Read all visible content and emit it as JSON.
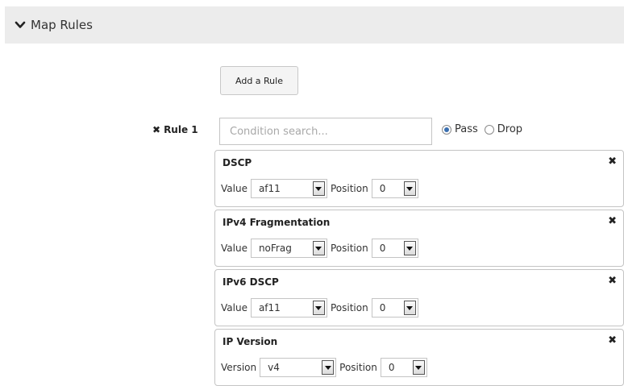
{
  "section": {
    "title": "Map Rules",
    "icon": "chevron-down-icon"
  },
  "add_rule_button": "Add a Rule",
  "rule": {
    "label": "Rule 1",
    "remove_icon": "close-icon",
    "search_placeholder": "Condition search...",
    "search_value": "",
    "action_options": [
      "Pass",
      "Drop"
    ],
    "action_selected": "Pass"
  },
  "conditions": [
    {
      "title": "DSCP",
      "field_label": "Value",
      "value": "af11",
      "position_label": "Position",
      "position": "0"
    },
    {
      "title": "IPv4 Fragmentation",
      "field_label": "Value",
      "value": "noFrag",
      "position_label": "Position",
      "position": "0"
    },
    {
      "title": "IPv6 DSCP",
      "field_label": "Value",
      "value": "af11",
      "position_label": "Position",
      "position": "0"
    },
    {
      "title": "IP Version",
      "field_label": "Version",
      "value": "v4",
      "position_label": "Position",
      "position": "0"
    }
  ],
  "close_glyph": "✖",
  "colors": {
    "header_bg": "#ececec",
    "radio_accent": "#3a6fb0"
  }
}
